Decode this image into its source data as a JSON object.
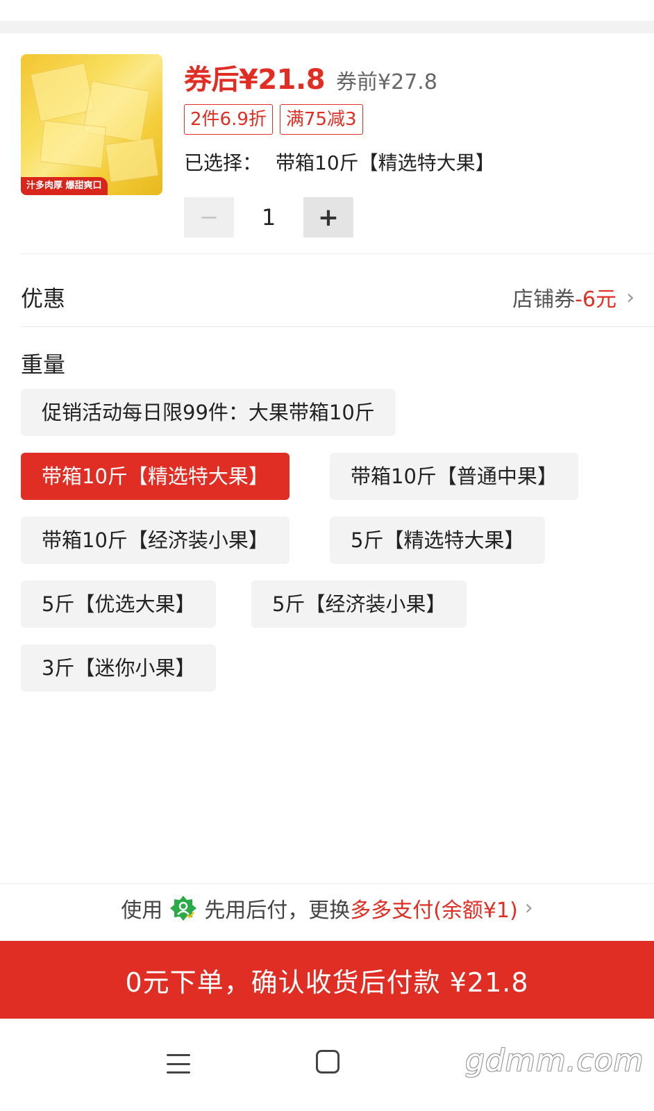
{
  "product": {
    "image_caption": "汁多肉厚 爆甜爽口",
    "price_after_coupon": "券后¥21.8",
    "price_before_coupon": "券前¥27.8",
    "promo_tags": [
      "2件6.9折",
      "满75减3"
    ],
    "selected_label": "已选择：",
    "selected_value": "带箱10斤【精选特大果】",
    "quantity": {
      "minus": "−",
      "value": "1",
      "plus": "+"
    }
  },
  "coupon": {
    "title": "优惠",
    "label": "店铺券",
    "amount": "-6元",
    "chevron": "›"
  },
  "weight": {
    "title": "重量",
    "options": [
      {
        "label": "促销活动每日限99件：大果带箱10斤",
        "selected": false
      },
      {
        "label": "带箱10斤【精选特大果】",
        "selected": true
      },
      {
        "label": "带箱10斤【普通中果】",
        "selected": false
      },
      {
        "label": "带箱10斤【经济装小果】",
        "selected": false
      },
      {
        "label": "5斤【精选特大果】",
        "selected": false
      },
      {
        "label": "5斤【优选大果】",
        "selected": false
      },
      {
        "label": "5斤【经济装小果】",
        "selected": false
      },
      {
        "label": "3斤【迷你小果】",
        "selected": false
      }
    ]
  },
  "payment": {
    "prefix": "使用",
    "method_a": "先用后付，更换",
    "method_b": "多多支付(余额¥1)",
    "chevron": "›",
    "badge_icon": "pay-later-badge-icon",
    "badge_color": "#2bab47"
  },
  "cta": {
    "label": "0元下单，确认收货后付款 ¥21.8"
  },
  "watermark": "gdmm.com",
  "colors": {
    "accent": "#e02e24",
    "chip_bg": "#f3f3f3"
  }
}
